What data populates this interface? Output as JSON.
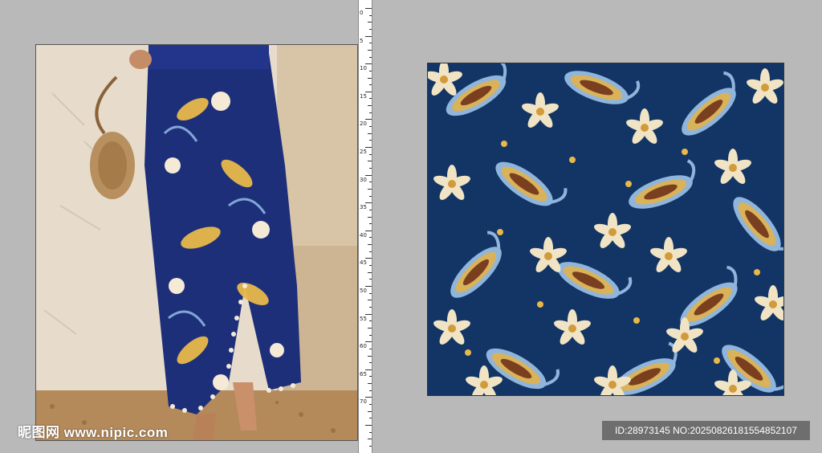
{
  "watermark": {
    "text": "昵图网 www.nipic.com"
  },
  "id_badge": {
    "text": "ID:28973145 NO:20250826181554852107"
  },
  "ruler": {
    "labels": [
      "0",
      "5",
      "10",
      "15",
      "20",
      "25",
      "30",
      "35",
      "40",
      "45",
      "50",
      "55",
      "60",
      "65",
      "70"
    ]
  },
  "colors": {
    "canvas": "#b9b9b9",
    "pattern_bg": "#123565",
    "badge_bg": "#6e6e6e"
  }
}
